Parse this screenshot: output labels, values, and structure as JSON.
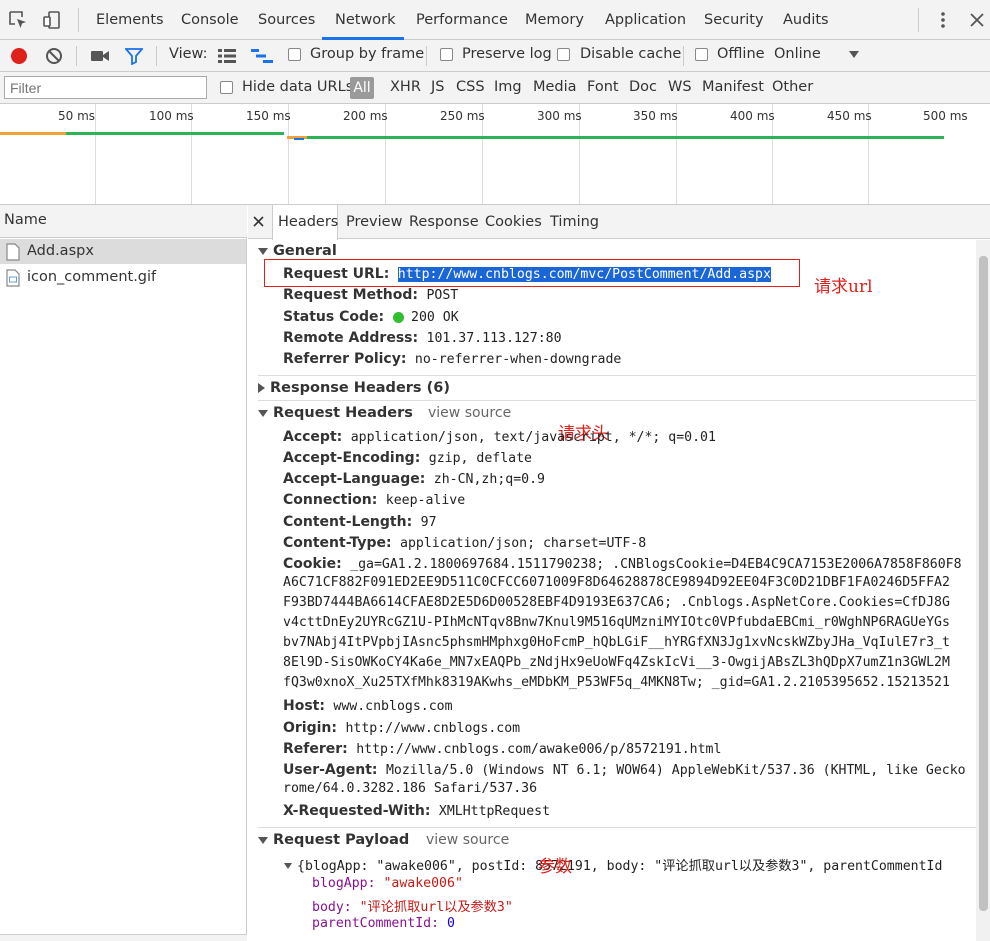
{
  "tabs": [
    "Elements",
    "Console",
    "Sources",
    "Network",
    "Performance",
    "Memory",
    "Application",
    "Security",
    "Audits"
  ],
  "active_tab": "Network",
  "toolbar": {
    "view_label": "View:",
    "group_by_frame": "Group by frame",
    "preserve_log": "Preserve log",
    "disable_cache": "Disable cache",
    "offline": "Offline",
    "online": "Online"
  },
  "filter": {
    "placeholder": "Filter",
    "hide_data_urls": "Hide data URLs",
    "types": [
      "All",
      "XHR",
      "JS",
      "CSS",
      "Img",
      "Media",
      "Font",
      "Doc",
      "WS",
      "Manifest",
      "Other"
    ]
  },
  "timeline": {
    "ticks": [
      "50 ms",
      "100 ms",
      "150 ms",
      "200 ms",
      "250 ms",
      "300 ms",
      "350 ms",
      "400 ms",
      "450 ms",
      "500 ms"
    ]
  },
  "requests": {
    "header": "Name",
    "items": [
      "Add.aspx",
      "icon_comment.gif"
    ]
  },
  "detail_tabs": [
    "Headers",
    "Preview",
    "Response",
    "Cookies",
    "Timing"
  ],
  "general": {
    "title": "General",
    "request_url_label": "Request URL:",
    "request_url": "http://www.cnblogs.com/mvc/PostComment/Add.aspx",
    "method_label": "Request Method:",
    "method": "POST",
    "status_label": "Status Code:",
    "status": "200 OK",
    "status_color": "#2fbf2f",
    "remote_label": "Remote Address:",
    "remote": "101.37.113.127:80",
    "referrer_policy_label": "Referrer Policy:",
    "referrer_policy": "no-referrer-when-downgrade"
  },
  "response_headers": {
    "title": "Response Headers (6)"
  },
  "request_headers": {
    "title": "Request Headers",
    "view_source": "view source",
    "accept_label": "Accept:",
    "accept": "application/json, text/javascript, */*; q=0.01",
    "accept_encoding_label": "Accept-Encoding:",
    "accept_encoding": "gzip, deflate",
    "accept_language_label": "Accept-Language:",
    "accept_language": "zh-CN,zh;q=0.9",
    "connection_label": "Connection:",
    "connection": "keep-alive",
    "content_length_label": "Content-Length:",
    "content_length": "97",
    "content_type_label": "Content-Type:",
    "content_type": "application/json; charset=UTF-8",
    "cookie_label": "Cookie:",
    "cookie_lines": [
      "_ga=GA1.2.1800697684.1511790238; .CNBlogsCookie=D4EB4C9CA7153E2006A7858F860F8",
      "A6C71CF882F091ED2EE9D511C0CFCC6071009F8D64628878CE9894D92EE04F3C0D21DBF1FA0246D5FFA2",
      "F93BD7444BA6614CFAE8D2E5D6D00528EBF4D9193E637CA6; .Cnblogs.AspNetCore.Cookies=CfDJ8G",
      "v4cttDnEy2UYRcGZ1U-PIhMcNTqv8Bnw7Knul9M516qUMzniMYIOtc0VPfubdaEBCmi_r0WghNP6RAGUeYGs",
      "bv7NAbj4ItPVpbjIAsnc5phsmHMphxg0HoFcmP_hQbLGiF__hYRGfXN3Jg1xvNcskWZbyJHa_VqIulE7r3_t",
      "8El9D-SisOWKoCY4Ka6e_MN7xEAQPb_zNdjHx9eUoWFq4ZskIcVi__3-OwgijABsZL3hQDpX7umZ1n3GWL2M",
      "fQ3w0xnoX_Xu25TXfMhk8319AKwhs_eMDbKM_P53WF5q_4MKN8Tw; _gid=GA1.2.2105395652.15213521"
    ],
    "host_label": "Host:",
    "host": "www.cnblogs.com",
    "origin_label": "Origin:",
    "origin": "http://www.cnblogs.com",
    "referer_label": "Referer:",
    "referer": "http://www.cnblogs.com/awake006/p/8572191.html",
    "user_agent_label": "User-Agent:",
    "user_agent": "Mozilla/5.0 (Windows NT 6.1; WOW64) AppleWebKit/537.36 (KHTML, like Gecko",
    "user_agent_cont": "rome/64.0.3282.186 Safari/537.36",
    "xrw_label": "X-Requested-With:",
    "xrw": "XMLHttpRequest"
  },
  "payload": {
    "title": "Request Payload",
    "view_source": "view source",
    "summary": "{blogApp: \"awake006\", postId: 8572191, body: \"评论抓取url以及参数3\", parentCommentId",
    "blog_app_key": "blogApp:",
    "blog_app_val": "\"awake006\"",
    "body_key": "body:",
    "body_val": "\"评论抓取url以及参数3\"",
    "parent_key": "parentCommentId:",
    "parent_val": "0"
  },
  "annotations": {
    "url_note": "请求url",
    "header_note": "请求头",
    "param_note": "参数"
  },
  "colors": {
    "record": "#e0201b",
    "accent": "#1a73e8",
    "highlight": "#1a66d6",
    "annotation": "#e0201b",
    "string": "#c41a16",
    "key": "#881391",
    "number": "#1c00cf"
  }
}
